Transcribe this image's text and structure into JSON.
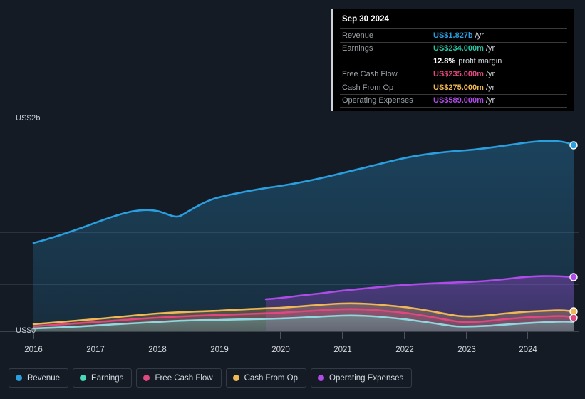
{
  "background_color": "#151b24",
  "axis": {
    "y_top_label": "US$2b",
    "y_bottom_label": "US$0",
    "x_ticks": [
      "2016",
      "2017",
      "2018",
      "2019",
      "2020",
      "2021",
      "2022",
      "2023",
      "2024"
    ]
  },
  "tooltip": {
    "date": "Sep 30 2024",
    "rows": [
      {
        "key": "Revenue",
        "value": "US$1.827b",
        "unit": "/yr",
        "color": "#2a9fe0"
      },
      {
        "key": "Earnings",
        "value": "US$234.000m",
        "unit": "/yr",
        "color": "#2bc4a0"
      },
      {
        "key": "",
        "value": "12.8%",
        "unit": "profit margin",
        "color": "#ffffff"
      },
      {
        "key": "Free Cash Flow",
        "value": "US$235.000m",
        "unit": "/yr",
        "color": "#e0487f"
      },
      {
        "key": "Cash From Op",
        "value": "US$275.000m",
        "unit": "/yr",
        "color": "#f0b755"
      },
      {
        "key": "Operating Expenses",
        "value": "US$589.000m",
        "unit": "/yr",
        "color": "#b04ae8"
      }
    ]
  },
  "legend": {
    "items": [
      {
        "label": "Revenue",
        "color": "#2a9fe0"
      },
      {
        "label": "Earnings",
        "color": "#4ad9b8"
      },
      {
        "label": "Free Cash Flow",
        "color": "#e0487f"
      },
      {
        "label": "Cash From Op",
        "color": "#f0b755"
      },
      {
        "label": "Operating Expenses",
        "color": "#b04ae8"
      }
    ]
  },
  "chart_data": {
    "type": "area",
    "title": "",
    "xlabel": "",
    "ylabel": "US$",
    "ylim": [
      0,
      2000
    ],
    "y_unit": "millions USD",
    "gridlines_y": [
      0,
      500,
      1000,
      1500,
      2000
    ],
    "grid": true,
    "legend_position": "bottom",
    "x": [
      "2016",
      "2016.5",
      "2017",
      "2017.5",
      "2018",
      "2018.5",
      "2019",
      "2019.5",
      "2020",
      "2020.5",
      "2021",
      "2021.5",
      "2022",
      "2022.5",
      "2023",
      "2023.5",
      "2024",
      "2024.75"
    ],
    "series": [
      {
        "name": "Revenue",
        "color": "#2a9fe0",
        "values": [
          845,
          900,
          960,
          1025,
          1090,
          1060,
          1135,
          1190,
          1215,
          1255,
          1300,
          1375,
          1440,
          1490,
          1540,
          1640,
          1740,
          1827
        ]
      },
      {
        "name": "Earnings",
        "color": "#4ad9b8",
        "values": [
          40,
          50,
          62,
          72,
          85,
          95,
          100,
          105,
          112,
          130,
          140,
          135,
          120,
          100,
          95,
          130,
          165,
          234
        ]
      },
      {
        "name": "Free Cash Flow",
        "color": "#e0487f",
        "values": [
          55,
          65,
          78,
          90,
          105,
          115,
          120,
          128,
          140,
          160,
          170,
          165,
          150,
          120,
          135,
          175,
          205,
          235
        ]
      },
      {
        "name": "Cash From Op",
        "color": "#f0b755",
        "values": [
          72,
          85,
          100,
          115,
          130,
          142,
          150,
          158,
          172,
          195,
          205,
          200,
          185,
          155,
          170,
          215,
          250,
          275
        ]
      },
      {
        "name": "Operating Expenses",
        "color": "#b04ae8",
        "values": [
          null,
          null,
          null,
          null,
          null,
          null,
          null,
          310,
          345,
          370,
          395,
          420,
          440,
          455,
          470,
          510,
          560,
          589
        ]
      }
    ]
  }
}
